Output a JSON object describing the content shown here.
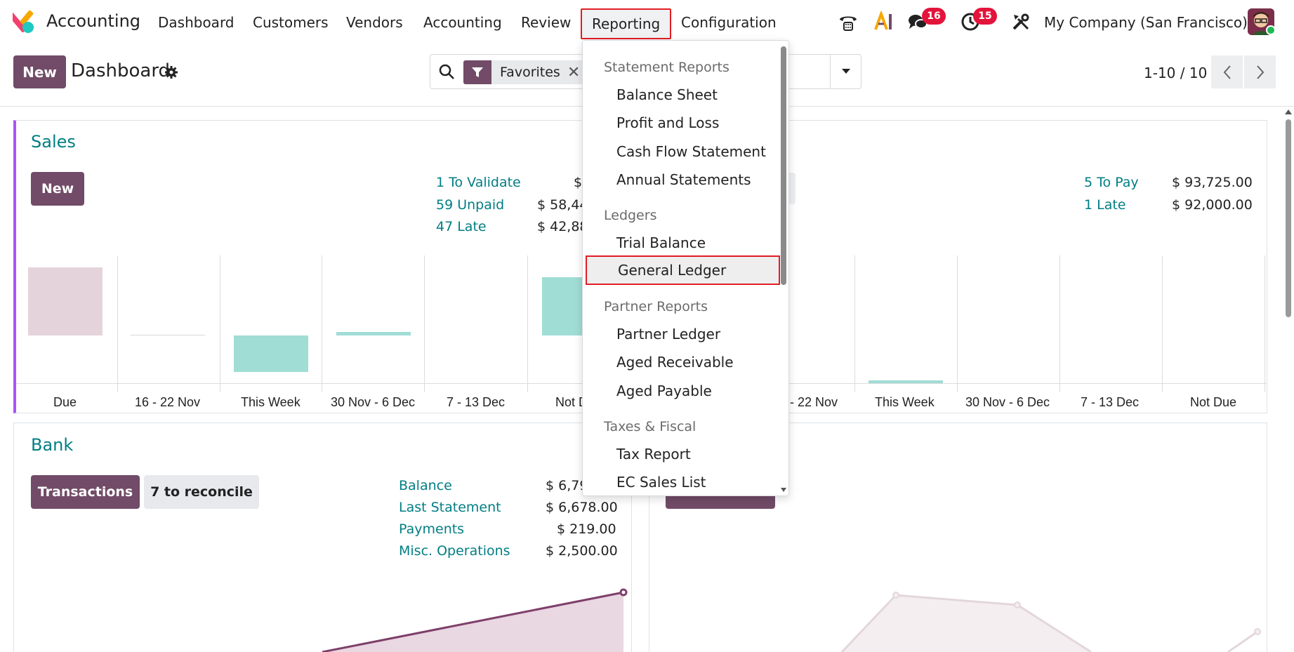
{
  "app": {
    "name": "Accounting"
  },
  "menu": [
    {
      "label": "Dashboard"
    },
    {
      "label": "Customers"
    },
    {
      "label": "Vendors"
    },
    {
      "label": "Accounting"
    },
    {
      "label": "Review"
    },
    {
      "label": "Reporting"
    },
    {
      "label": "Configuration"
    }
  ],
  "systray": {
    "messages_count": "16",
    "activities_count": "15",
    "company": "My Company (San Francisco)"
  },
  "control_panel": {
    "new_label": "New",
    "title": "Dashboard",
    "facet_label": "Favorites",
    "pager": "1-10 / 10"
  },
  "sales_card": {
    "title": "Sales",
    "new_label": "New",
    "stats": [
      {
        "label": "1 To Validate",
        "amount": "$"
      },
      {
        "label": "59 Unpaid",
        "amount": "$ 58,44"
      },
      {
        "label": "47 Late",
        "amount": "$ 42,88"
      }
    ],
    "chart_labels": [
      "Due",
      "16 - 22 Nov",
      "This Week",
      "30 Nov - 6 Dec",
      "7 - 13 Dec",
      "Not D"
    ]
  },
  "purchases_card": {
    "stats": [
      {
        "label": "5 To Pay",
        "amount": "$ 93,725.00"
      },
      {
        "label": "1 Late",
        "amount": "$ 92,000.00"
      }
    ],
    "chart_labels": [
      "- 22 Nov",
      "This Week",
      "30 Nov - 6 Dec",
      "7 - 13 Dec",
      "Not Due"
    ]
  },
  "bank_card": {
    "title": "Bank",
    "transactions_label": "Transactions",
    "reconcile_label": "7 to reconcile",
    "stats": [
      {
        "label": "Balance",
        "amount": "$ 6,79"
      },
      {
        "label": "Last Statement",
        "amount": "$ 6,678.00"
      },
      {
        "label": "Payments",
        "amount": "$ 219.00"
      },
      {
        "label": "Misc. Operations",
        "amount": "$ 2,500.00"
      }
    ]
  },
  "reporting_dropdown": {
    "sections": [
      {
        "header": "Statement Reports",
        "items": [
          "Balance Sheet",
          "Profit and Loss",
          "Cash Flow Statement",
          "Annual Statements"
        ]
      },
      {
        "header": "Ledgers",
        "items": [
          "Trial Balance",
          "General Ledger"
        ]
      },
      {
        "header": "Partner Reports",
        "items": [
          "Partner Ledger",
          "Aged Receivable",
          "Aged Payable"
        ]
      },
      {
        "header": "Taxes & Fiscal",
        "items": [
          "Tax Report",
          "EC Sales List"
        ]
      }
    ]
  },
  "colors": {
    "brand": "#714b67",
    "link": "#017e84",
    "highlight": "#e11d24"
  }
}
